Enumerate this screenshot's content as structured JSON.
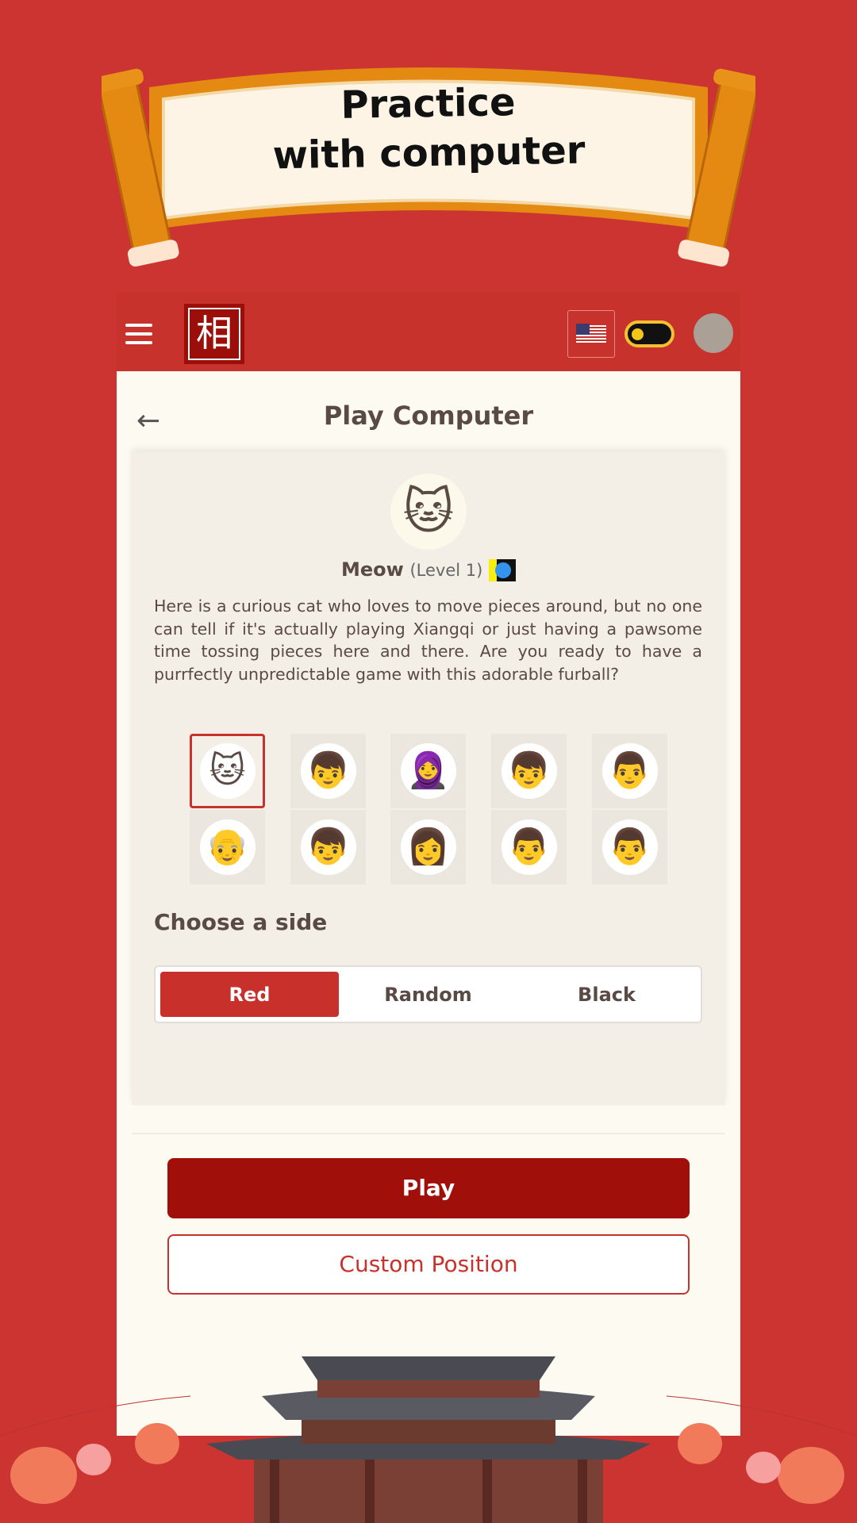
{
  "banner": {
    "title_line1": "Practice",
    "title_line2": "with computer"
  },
  "topbar": {
    "menu_icon": "hamburger-icon",
    "logo": "相",
    "language": "English (US flag)",
    "theme_toggle": "sun-icon"
  },
  "page": {
    "title": "Play Computer",
    "back_icon": "arrow-left-icon"
  },
  "bot": {
    "name": "Meow",
    "level": "(Level 1)",
    "description": "Here is a curious cat who loves to move pieces around, but no one can tell if it's actually playing Xiangqi or just having a pawsome time tossing pieces here and there. Are you ready to have a purrfectly unpredictable game with this adorable furball?"
  },
  "opponents": [
    {
      "icon": "🐱",
      "selected": true
    },
    {
      "icon": "👦"
    },
    {
      "icon": "🧕"
    },
    {
      "icon": "👦"
    },
    {
      "icon": "👨"
    },
    {
      "icon": "👴"
    },
    {
      "icon": "👦"
    },
    {
      "icon": "👩"
    },
    {
      "icon": "👨"
    },
    {
      "icon": "👨"
    }
  ],
  "side": {
    "label": "Choose a side",
    "options": [
      "Red",
      "Random",
      "Black"
    ],
    "selected": "Red"
  },
  "actions": {
    "play": "Play",
    "custom": "Custom Position"
  },
  "colors": {
    "background": "#cb3430",
    "primary": "#a00f0a",
    "accent": "#c7302b",
    "card": "#fdfbf1"
  }
}
